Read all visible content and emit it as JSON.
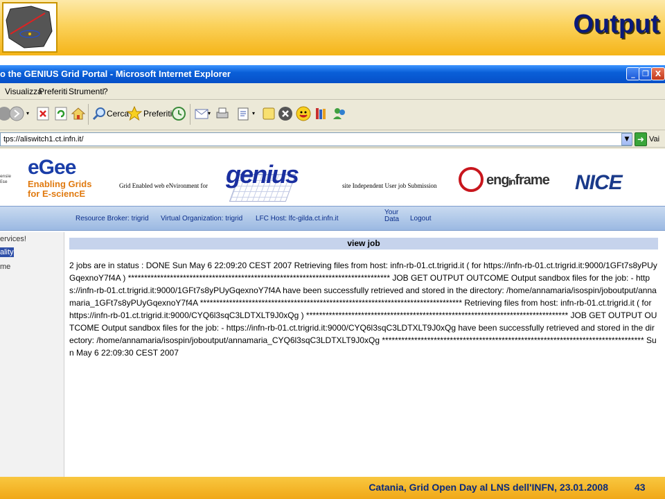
{
  "slide": {
    "title": "Output",
    "footer": "Catania, Grid Open Day al LNS dell'INFN, 23.01.2008",
    "page_number": "43"
  },
  "window": {
    "title": "o the GENIUS Grid Portal - Microsoft Internet Explorer",
    "buttons": [
      "_",
      "❐",
      "X"
    ]
  },
  "menu": {
    "items": [
      "Visualizza",
      "Preferiti",
      "Strumenti",
      "?"
    ]
  },
  "toolbar": {
    "search_label": "Cerca",
    "favorites_label": "Preferiti"
  },
  "address": {
    "url": "tps://aliswitch1.ct.infn.it/",
    "go_label": "Vai"
  },
  "banner": {
    "egee_side_text": "ensie\nEse",
    "egee_word": "eGee",
    "egee_sub1": "Enabling Grids",
    "egee_sub2": "for E-sciencE",
    "genius_tag_1": "Grid Enabled web eNvironment for",
    "genius_logo": "genius",
    "genius_tag_2": "site Independent User job Submission",
    "enginframe": "engᵢₙframe",
    "nice": "NICE"
  },
  "nav": {
    "resource_broker": "Resource Broker: trigrid",
    "virtual_org": "Virtual Organization: trigrid",
    "lfc_host": "LFC Host: lfc-gilda.ct.infn.it",
    "your_data_1": "Your",
    "your_data_2": "Data",
    "logout": "Logout"
  },
  "sidebar": {
    "items": [
      "ervices!",
      "ality",
      "me"
    ]
  },
  "content": {
    "header": "view job",
    "job_output": "2 jobs are in status : DONE Sun May 6 22:09:20 CEST 2007 Retrieving files from host: infn-rb-01.ct.trigrid.it ( for https://infn-rb-01.ct.trigrid.it:9000/1GFt7s8yPUyGqexnoY7f4A ) ********************************************************************************* JOB GET OUTPUT OUTCOME Output sandbox files for the job: - https://infn-rb-01.ct.trigrid.it:9000/1GFt7s8yPUyGqexnoY7f4A have been successfully retrieved and stored in the directory: /home/annamaria/isospin/joboutput/annamaria_1GFt7s8yPUyGqexnoY7f4A ********************************************************************************* Retrieving files from host: infn-rb-01.ct.trigrid.it ( for https://infn-rb-01.ct.trigrid.it:9000/CYQ6l3sqC3LDTXLT9J0xQg ) ********************************************************************************* JOB GET OUTPUT OUTCOME Output sandbox files for the job: - https://infn-rb-01.ct.trigrid.it:9000/CYQ6l3sqC3LDTXLT9J0xQg have been successfully retrieved and stored in the directory: /home/annamaria/isospin/joboutput/annamaria_CYQ6l3sqC3LDTXLT9J0xQg ********************************************************************************* Sun May 6 22:09:30 CEST 2007"
  }
}
